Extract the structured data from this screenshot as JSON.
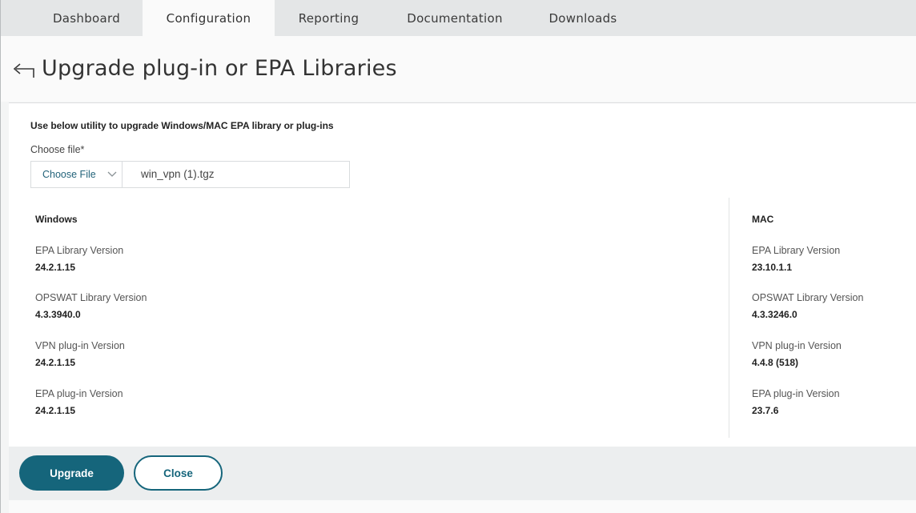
{
  "nav": {
    "tabs": [
      {
        "label": "Dashboard"
      },
      {
        "label": "Configuration"
      },
      {
        "label": "Reporting"
      },
      {
        "label": "Documentation"
      },
      {
        "label": "Downloads"
      }
    ],
    "active_tab": "Configuration"
  },
  "header": {
    "title": "Upgrade plug-in or EPA Libraries",
    "back_icon": "back-arrow-icon"
  },
  "form": {
    "intro": "Use below utility to upgrade Windows/MAC EPA library or plug-ins",
    "file_label": "Choose file*",
    "choose_button": "Choose File",
    "file_name": "win_vpn (1).tgz"
  },
  "windows": {
    "title": "Windows",
    "fields": [
      {
        "label": "EPA Library Version",
        "value": "24.2.1.15"
      },
      {
        "label": "OPSWAT Library Version",
        "value": "4.3.3940.0"
      },
      {
        "label": "VPN plug-in Version",
        "value": "24.2.1.15"
      },
      {
        "label": "EPA plug-in Version",
        "value": "24.2.1.15"
      }
    ]
  },
  "mac": {
    "title": "MAC",
    "fields": [
      {
        "label": "EPA Library Version",
        "value": "23.10.1.1"
      },
      {
        "label": "OPSWAT Library Version",
        "value": "4.3.3246.0"
      },
      {
        "label": "VPN plug-in Version",
        "value": "4.4.8 (518)"
      },
      {
        "label": "EPA plug-in Version",
        "value": "23.7.6"
      }
    ]
  },
  "footer": {
    "upgrade_label": "Upgrade",
    "close_label": "Close"
  },
  "colors": {
    "accent": "#15657b",
    "nav_background": "#e4e6e7",
    "footer_background": "#eceeef"
  }
}
